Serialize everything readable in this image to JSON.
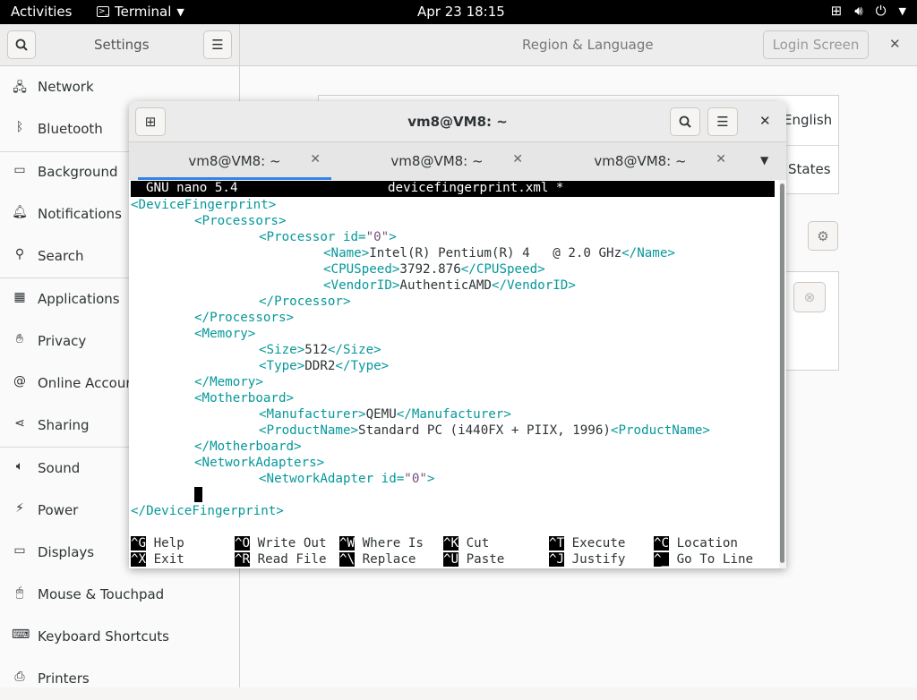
{
  "topbar": {
    "activities": "Activities",
    "app_name": "Terminal",
    "clock": "Apr 23  18:15",
    "tray": [
      "network-icon",
      "volume-icon",
      "power-icon",
      "chevron-down-icon"
    ]
  },
  "settings": {
    "title": "Settings",
    "panel_title": "Region & Language",
    "login_screen": "Login Screen",
    "sidebar": [
      {
        "label": "Network",
        "icon": "network-icon"
      },
      {
        "label": "Bluetooth",
        "icon": "bluetooth-icon"
      },
      {
        "label": "Background",
        "icon": "background-icon"
      },
      {
        "label": "Notifications",
        "icon": "bell-icon"
      },
      {
        "label": "Search",
        "icon": "search-icon"
      },
      {
        "label": "Applications",
        "icon": "grid-icon"
      },
      {
        "label": "Privacy",
        "icon": "hand-icon"
      },
      {
        "label": "Online Accounts",
        "icon": "at-icon"
      },
      {
        "label": "Sharing",
        "icon": "share-icon"
      },
      {
        "label": "Sound",
        "icon": "speaker-icon"
      },
      {
        "label": "Power",
        "icon": "power-icon"
      },
      {
        "label": "Displays",
        "icon": "display-icon"
      },
      {
        "label": "Mouse & Touchpad",
        "icon": "mouse-icon"
      },
      {
        "label": "Keyboard Shortcuts",
        "icon": "keyboard-icon"
      },
      {
        "label": "Printers",
        "icon": "printer-icon"
      }
    ],
    "peek": {
      "language": "English",
      "formats": "States"
    }
  },
  "terminal": {
    "title": "vm8@VM8: ~",
    "tabs": [
      {
        "label": "vm8@VM8: ~",
        "active": true
      },
      {
        "label": "vm8@VM8: ~",
        "active": false
      },
      {
        "label": "vm8@VM8: ~",
        "active": false
      }
    ],
    "nano": {
      "version": "GNU nano 5.4",
      "filename": "devicefingerprint.xml *",
      "lines": {
        "l1": "<DeviceFingerprint>",
        "l2": "<Processors>",
        "l3a": "<Processor ",
        "l3b": "id=",
        "l3c": "\"0\"",
        "l3d": ">",
        "l4a": "<Name>",
        "l4b": "Intel(R) Pentium(R) 4   @ 2.0 GHz",
        "l4c": "</Name>",
        "l5a": "<CPUSpeed>",
        "l5b": "3792.876",
        "l5c": "</CPUSpeed>",
        "l6a": "<VendorID>",
        "l6b": "AuthenticAMD",
        "l6c": "</VendorID>",
        "l7": "</Processor>",
        "l8": "</Processors>",
        "l9": "<Memory>",
        "l10a": "<Size>",
        "l10b": "512",
        "l10c": "</Size>",
        "l11a": "<Type>",
        "l11b": "DDR2",
        "l11c": "</Type>",
        "l12": "</Memory>",
        "l13": "<Motherboard>",
        "l14a": "<Manufacturer>",
        "l14b": "QEMU",
        "l14c": "</Manufacturer>",
        "l15a": "<ProductName>",
        "l15b": "Standard PC (i440FX + PIIX, 1996)",
        "l15c": "<ProductName>",
        "l16": "</Motherboard>",
        "l17": "<NetworkAdapters>",
        "l18a": "<NetworkAdapter ",
        "l18b": "id=",
        "l18c": "\"0\"",
        "l18d": ">",
        "l20": "</DeviceFingerprint>"
      },
      "shortcuts": [
        {
          "key": "^G",
          "label": "Help"
        },
        {
          "key": "^O",
          "label": "Write Out"
        },
        {
          "key": "^W",
          "label": "Where Is"
        },
        {
          "key": "^K",
          "label": "Cut"
        },
        {
          "key": "^T",
          "label": "Execute"
        },
        {
          "key": "^C",
          "label": "Location"
        },
        {
          "key": "^X",
          "label": "Exit"
        },
        {
          "key": "^R",
          "label": "Read File"
        },
        {
          "key": "^\\",
          "label": "Replace"
        },
        {
          "key": "^U",
          "label": "Paste"
        },
        {
          "key": "^J",
          "label": "Justify"
        },
        {
          "key": "^_",
          "label": "Go To Line"
        }
      ]
    }
  }
}
